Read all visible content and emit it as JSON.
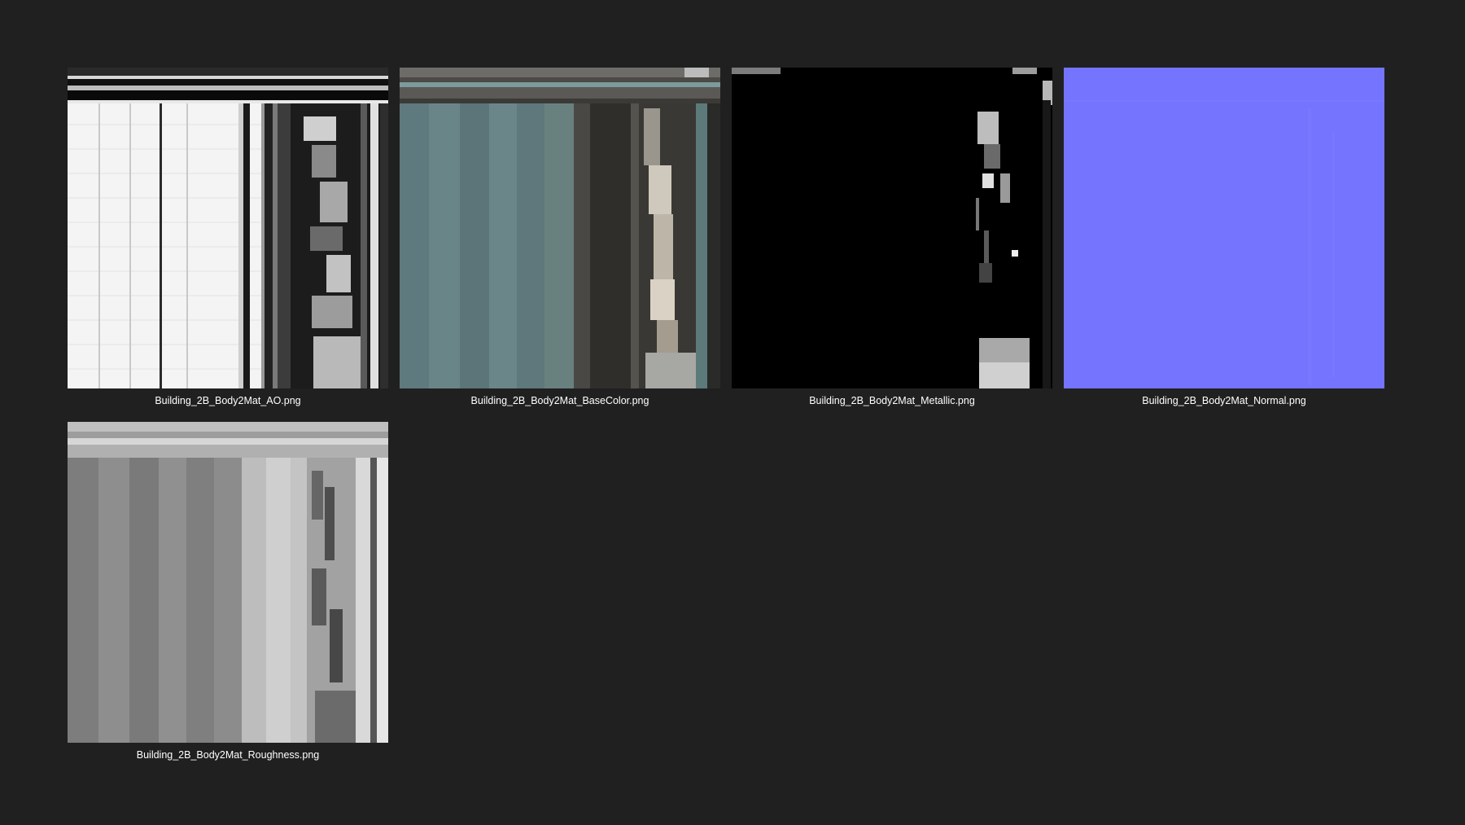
{
  "files": [
    {
      "name": "Building_2B_Body2Mat_AO.png",
      "kind": "ao-texture"
    },
    {
      "name": "Building_2B_Body2Mat_BaseColor.png",
      "kind": "basecolor-texture"
    },
    {
      "name": "Building_2B_Body2Mat_Metallic.png",
      "kind": "metallic-texture"
    },
    {
      "name": "Building_2B_Body2Mat_Normal.png",
      "kind": "normal-texture"
    },
    {
      "name": "Building_2B_Body2Mat_Roughness.png",
      "kind": "roughness-texture"
    }
  ],
  "colors": {
    "background": "#202020",
    "caption": "#ffffff",
    "normal_map": "#7474ff",
    "basecolor_teal": "#5f7a7e"
  }
}
